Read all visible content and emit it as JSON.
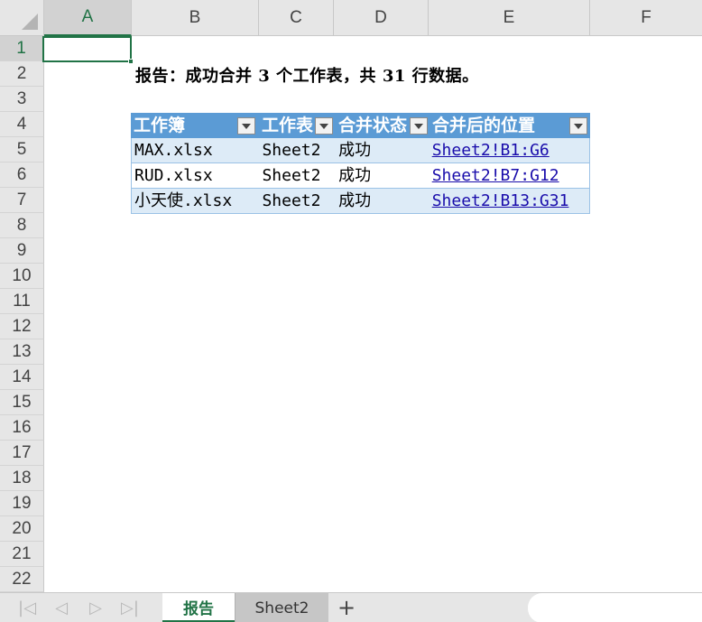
{
  "columns": [
    "A",
    "B",
    "C",
    "D",
    "E",
    "F"
  ],
  "rows": [
    "1",
    "2",
    "3",
    "4",
    "5",
    "6",
    "7",
    "8",
    "9",
    "10",
    "11",
    "12",
    "13",
    "14",
    "15",
    "16",
    "17",
    "18",
    "19",
    "20",
    "21",
    "22"
  ],
  "active_cell": "A1",
  "report_text": "报告：成功合并 3 个工作表，共 31 行数据。",
  "table": {
    "headers": [
      "工作簿",
      "工作表",
      "合并状态",
      "合并后的位置"
    ],
    "rows": [
      [
        "MAX.xlsx",
        "Sheet2",
        "成功",
        "Sheet2!B1:G6"
      ],
      [
        "RUD.xlsx",
        "Sheet2",
        "成功",
        "Sheet2!B7:G12"
      ],
      [
        "小天使.xlsx",
        "Sheet2",
        "成功",
        "Sheet2!B13:G31"
      ]
    ]
  },
  "sheet_tabs": [
    {
      "label": "报告",
      "active": true
    },
    {
      "label": "Sheet2",
      "active": false
    }
  ],
  "nav": {
    "first": "|◁",
    "prev": "◁",
    "next": "▷",
    "last": "▷|",
    "add": "+"
  },
  "colors": {
    "accent": "#217346",
    "table_header": "#5b9bd5",
    "table_band": "#ddebf7",
    "link": "#1a0dab"
  }
}
